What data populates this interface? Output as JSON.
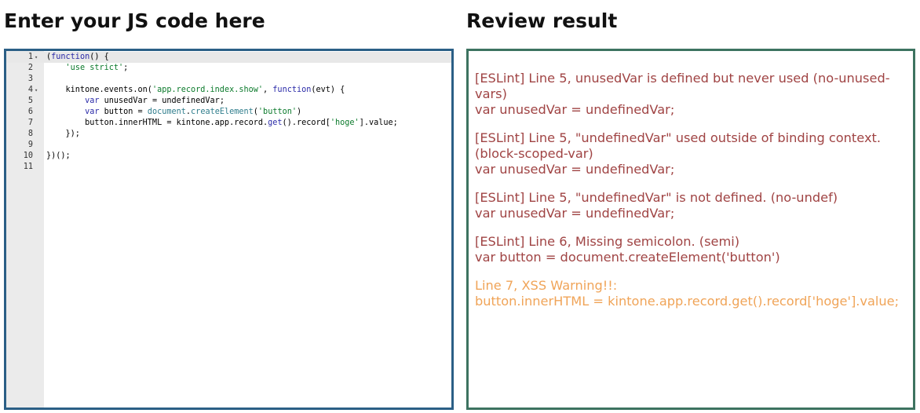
{
  "left_panel": {
    "title": "Enter your JS code here"
  },
  "right_panel": {
    "title": "Review result"
  },
  "editor": {
    "lines": [
      {
        "number": "1",
        "fold": "▾",
        "tokens": [
          {
            "t": "(",
            "c": "pl"
          },
          {
            "t": "function",
            "c": "kw"
          },
          {
            "t": "() {",
            "c": "pl"
          }
        ]
      },
      {
        "number": "2",
        "fold": "",
        "tokens": [
          {
            "t": "    ",
            "c": "pl"
          },
          {
            "t": "'use strict'",
            "c": "str"
          },
          {
            "t": ";",
            "c": "pl"
          }
        ]
      },
      {
        "number": "3",
        "fold": "",
        "tokens": []
      },
      {
        "number": "4",
        "fold": "▾",
        "tokens": [
          {
            "t": "    kintone.events.on(",
            "c": "pl"
          },
          {
            "t": "'app.record.index.show'",
            "c": "str"
          },
          {
            "t": ", ",
            "c": "pl"
          },
          {
            "t": "function",
            "c": "kw"
          },
          {
            "t": "(evt) {",
            "c": "pl"
          }
        ]
      },
      {
        "number": "5",
        "fold": "",
        "tokens": [
          {
            "t": "        ",
            "c": "pl"
          },
          {
            "t": "var",
            "c": "kw"
          },
          {
            "t": " unusedVar = undefinedVar;",
            "c": "pl"
          }
        ]
      },
      {
        "number": "6",
        "fold": "",
        "tokens": [
          {
            "t": "        ",
            "c": "pl"
          },
          {
            "t": "var",
            "c": "kw"
          },
          {
            "t": " button = ",
            "c": "pl"
          },
          {
            "t": "document",
            "c": "fn"
          },
          {
            "t": ".",
            "c": "pl"
          },
          {
            "t": "createElement",
            "c": "fn"
          },
          {
            "t": "(",
            "c": "pl"
          },
          {
            "t": "'button'",
            "c": "str"
          },
          {
            "t": ")",
            "c": "pl"
          }
        ]
      },
      {
        "number": "7",
        "fold": "",
        "tokens": [
          {
            "t": "        button.innerHTML = kintone.app.record.",
            "c": "pl"
          },
          {
            "t": "get",
            "c": "kw"
          },
          {
            "t": "().record[",
            "c": "pl"
          },
          {
            "t": "'hoge'",
            "c": "str"
          },
          {
            "t": "].value;",
            "c": "pl"
          }
        ]
      },
      {
        "number": "8",
        "fold": "",
        "tokens": [
          {
            "t": "    });",
            "c": "pl"
          }
        ]
      },
      {
        "number": "9",
        "fold": "",
        "tokens": []
      },
      {
        "number": "10",
        "fold": "",
        "tokens": [
          {
            "t": "})();",
            "c": "pl"
          }
        ]
      },
      {
        "number": "11",
        "fold": "",
        "tokens": []
      }
    ]
  },
  "results": [
    {
      "type": "error",
      "message": "[ESLint] Line 5, unusedVar is defined but never used (no-unused-vars)",
      "code": "var unusedVar = undefinedVar;"
    },
    {
      "type": "error",
      "message": "[ESLint] Line 5, \"undefinedVar\" used outside of binding context. (block-scoped-var)",
      "code": "var unusedVar = undefinedVar;"
    },
    {
      "type": "error",
      "message": "[ESLint] Line 5, \"undefinedVar\" is not defined. (no-undef)",
      "code": "var unusedVar = undefinedVar;"
    },
    {
      "type": "error",
      "message": "[ESLint] Line 6, Missing semicolon. (semi)",
      "code": "var button = document.createElement('button')"
    },
    {
      "type": "warn",
      "message": "Line 7, XSS Warning!!:",
      "code": "button.innerHTML = kintone.app.record.get().record['hoge'].value;"
    }
  ],
  "colors": {
    "editor_border": "#2b5f86",
    "result_border": "#3d7360",
    "error_text": "#a04444",
    "warning_text": "#f0a458"
  }
}
